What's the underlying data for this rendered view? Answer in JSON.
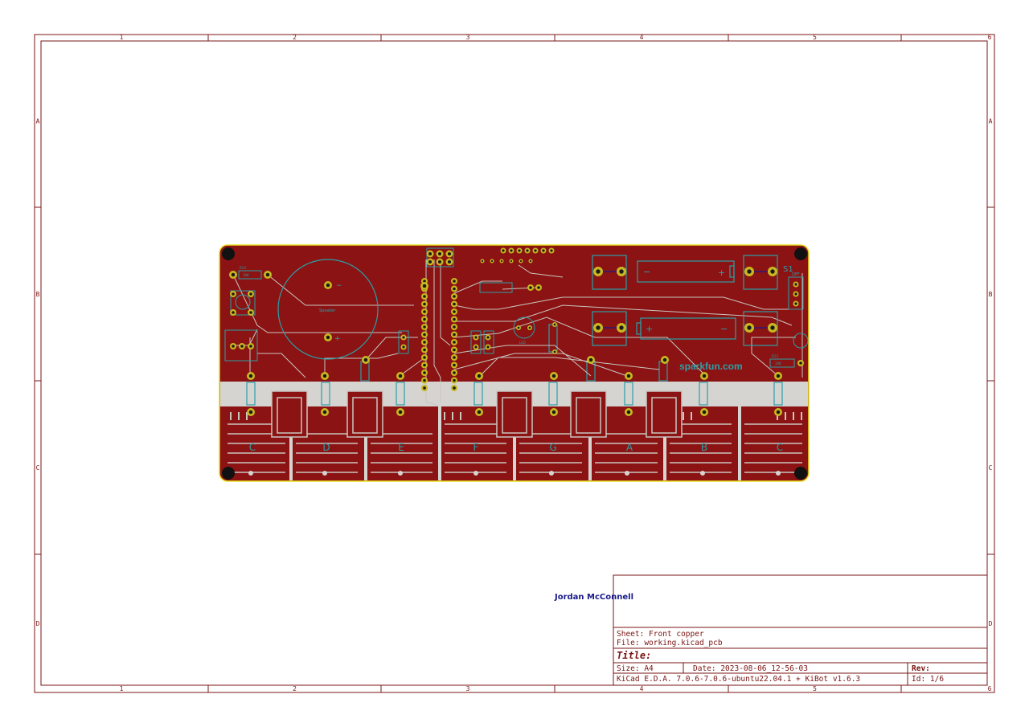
{
  "border": {
    "columns": [
      "1",
      "2",
      "3",
      "4",
      "5",
      "6"
    ],
    "rows": [
      "A",
      "B",
      "C",
      "D"
    ]
  },
  "author": "Jordan McConnell",
  "title_block": {
    "sheet": "Sheet: Front copper",
    "file": "File: working.kicad_pcb",
    "title": "Title:",
    "size": "Size: A4",
    "date": "Date: 2023-08-06_12-56-03",
    "rev": "Rev:",
    "tool": "KiCad E.D.A. 7.0.6-7.0.6-ubuntu22.04.1 + KiBot v1.6.3",
    "id": "Id: 1/6"
  },
  "pcb": {
    "colors": {
      "copper": "#8b1313",
      "substrate": "#d6d4d0",
      "edge": "#e8e020",
      "pad": "#c8b820",
      "silk": "#2aa0a8",
      "drill": "#1a1a1a"
    },
    "note_labels": [
      "C",
      "D",
      "E",
      "F",
      "G",
      "A",
      "B",
      "C"
    ],
    "logo": "sparkfun.com",
    "speaker_label": "Speaker",
    "switch_label": "S1",
    "switch_off": "OFF",
    "minus": "−",
    "plus": "+",
    "r14": "R14",
    "r14_value": "10K",
    "r13": "R13",
    "r13_value": "10K",
    "led_label": "LED"
  }
}
